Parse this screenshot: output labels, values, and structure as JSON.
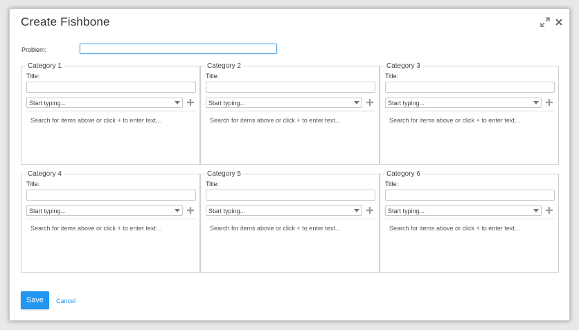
{
  "dialog": {
    "title": "Create Fishbone",
    "expand_icon": "expand-arrows-icon",
    "close_icon": "close-icon"
  },
  "problem": {
    "label": "Problem:",
    "value": ""
  },
  "categories": [
    {
      "legend": "Category 1",
      "title_label": "Title:",
      "title_value": "",
      "select_placeholder": "Start typing...",
      "empty_text": "Search for items above or click + to enter text..."
    },
    {
      "legend": "Category 2",
      "title_label": "Title:",
      "title_value": "",
      "select_placeholder": "Start typing...",
      "empty_text": "Search for items above or click + to enter text..."
    },
    {
      "legend": "Category 3",
      "title_label": "Title:",
      "title_value": "",
      "select_placeholder": "Start typing...",
      "empty_text": "Search for items above or click + to enter text..."
    },
    {
      "legend": "Category 4",
      "title_label": "Title:",
      "title_value": "",
      "select_placeholder": "Start typing...",
      "empty_text": "Search for items above or click + to enter text..."
    },
    {
      "legend": "Category 5",
      "title_label": "Title:",
      "title_value": "",
      "select_placeholder": "Start typing...",
      "empty_text": "Search for items above or click + to enter text..."
    },
    {
      "legend": "Category 6",
      "title_label": "Title:",
      "title_value": "",
      "select_placeholder": "Start typing...",
      "empty_text": "Search for items above or click + to enter text..."
    }
  ],
  "footer": {
    "save_label": "Save",
    "cancel_label": "Cancel"
  },
  "colors": {
    "accent": "#2196f3",
    "border": "#cfcfcf"
  }
}
